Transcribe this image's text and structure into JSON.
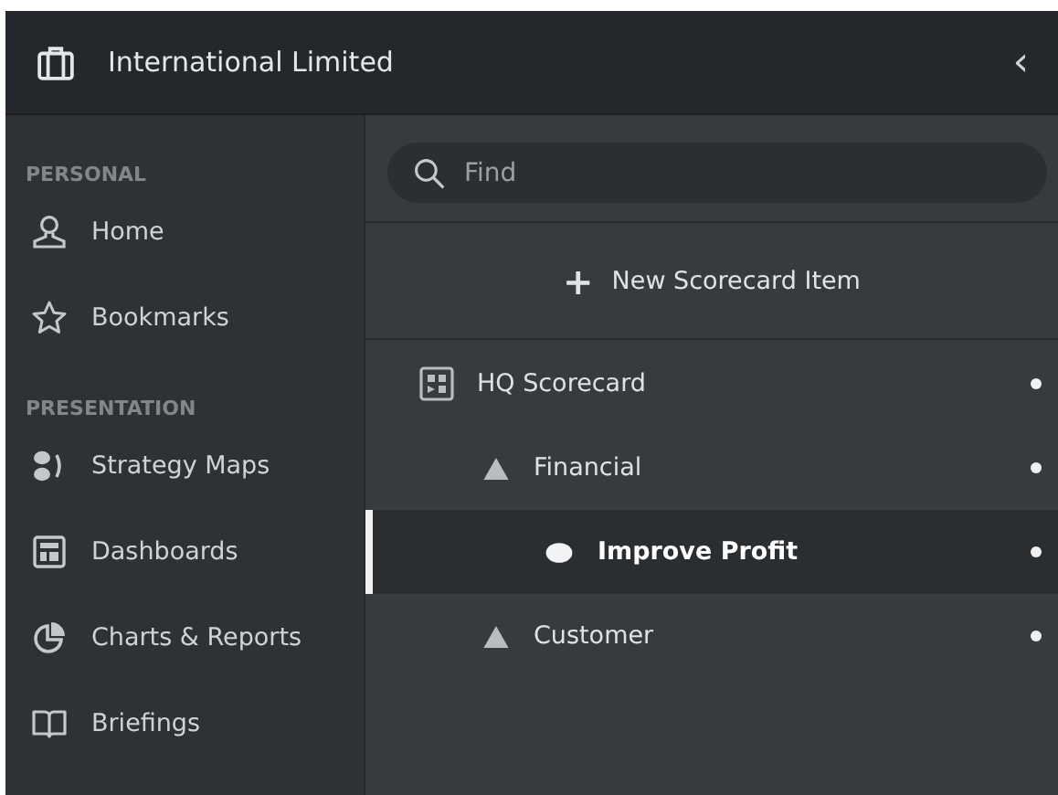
{
  "window": {
    "title": "International Limited",
    "collapse_glyph": "‹"
  },
  "sidebar": {
    "sections": [
      {
        "heading": "PERSONAL",
        "items": [
          {
            "label": "Home",
            "kind": "home"
          },
          {
            "label": "Bookmarks",
            "kind": "star"
          }
        ]
      },
      {
        "heading": "PRESENTATION",
        "items": [
          {
            "label": "Strategy Maps",
            "kind": "map"
          },
          {
            "label": "Dashboards",
            "kind": "dashboard"
          },
          {
            "label": "Charts & Reports",
            "kind": "chart"
          },
          {
            "label": "Briefings",
            "kind": "book"
          }
        ]
      }
    ]
  },
  "search": {
    "placeholder": "Find"
  },
  "new_item": {
    "glyph": "+",
    "label": "New Scorecard Item"
  },
  "tree": [
    {
      "label": "HQ Scorecard",
      "kind": "scorecard",
      "selected": false,
      "children": [
        {
          "label": "Financial",
          "kind": "perspective",
          "selected": false,
          "children": [
            {
              "label": "Improve Profit",
              "kind": "objective",
              "selected": true
            }
          ]
        },
        {
          "label": "Customer",
          "kind": "perspective",
          "selected": false
        }
      ]
    }
  ]
}
